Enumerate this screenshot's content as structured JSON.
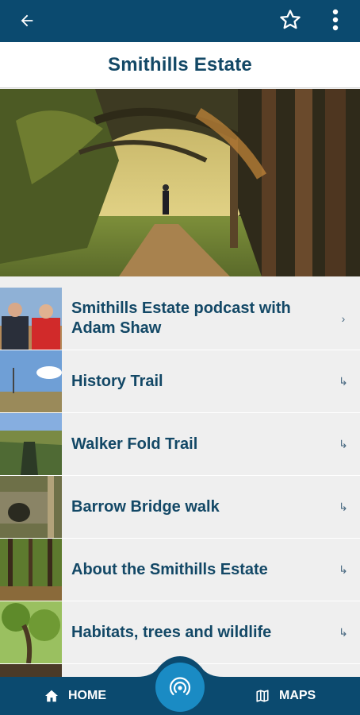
{
  "header": {
    "back_icon": "arrow-left-icon",
    "favorite_icon": "star-outline-icon",
    "menu_icon": "more-vertical-icon"
  },
  "page": {
    "title": "Smithills Estate"
  },
  "hero": {
    "description_icon": "woodland-path-photo"
  },
  "items": [
    {
      "label": "Smithills Estate podcast with Adam Shaw",
      "arrow": "›"
    },
    {
      "label": "History Trail",
      "arrow": "↳"
    },
    {
      "label": "Walker Fold Trail",
      "arrow": "↳"
    },
    {
      "label": "Barrow Bridge walk",
      "arrow": "↳"
    },
    {
      "label": "About the Smithills Estate",
      "arrow": "↳"
    },
    {
      "label": "Habitats, trees and wildlife",
      "arrow": "↳"
    }
  ],
  "bottom_nav": {
    "home_label": "HOME",
    "maps_label": "MAPS",
    "center_icon": "nfc-signal-icon"
  },
  "colors": {
    "primary": "#0b4a6f",
    "title_text": "#134866",
    "fab": "#1a8bc4",
    "list_bg": "#efefef"
  }
}
